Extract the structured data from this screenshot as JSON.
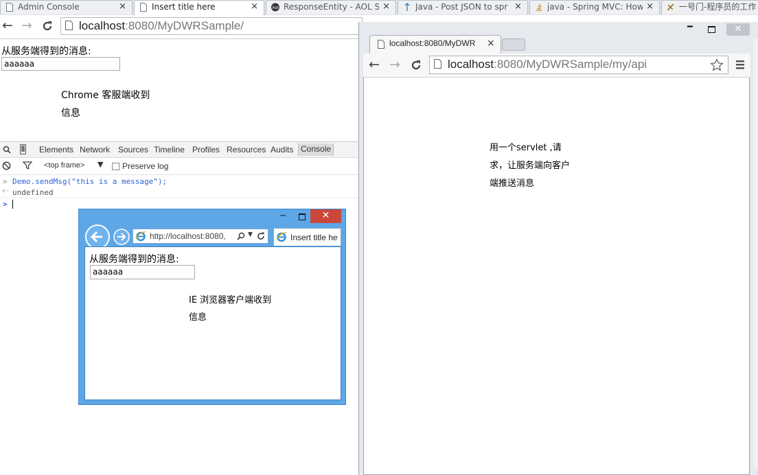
{
  "bg_browser": {
    "tabs": [
      {
        "label": "Admin Console",
        "icon": "page-icon",
        "close": "×",
        "active": false
      },
      {
        "label": "Insert title here",
        "icon": "page-icon",
        "close": "×",
        "active": true
      },
      {
        "label": "ResponseEntity - AOL S",
        "icon": "aol-icon",
        "close": "×",
        "active": false
      },
      {
        "label": "Java - Post JSON to spr",
        "icon": "stackoverflow-icon",
        "close": "×",
        "active": false
      },
      {
        "label": "java - Spring MVC: How",
        "icon": "stackoverflow-icon",
        "close": "×",
        "active": false
      },
      {
        "label": "一号门-程序员的工作",
        "icon": "site-icon",
        "close": "",
        "active": false
      }
    ],
    "url_host": "localhost",
    "url_rest": ":8080/MyDWRSample/",
    "page": {
      "message_label": "从服务端得到的消息:",
      "message_value": "aaaaaa",
      "annotation_line1": "Chrome 客服端收到",
      "annotation_line2": "信息"
    },
    "devtools": {
      "tabs": [
        "Elements",
        "Network",
        "Sources",
        "Timeline",
        "Profiles",
        "Resources",
        "Audits",
        "Console"
      ],
      "active_tab": "Console",
      "frame_select": "<top frame>",
      "preserve_log_label": "Preserve log",
      "console_input": "Demo.sendMsg(\"this is a message\");",
      "console_output": "undefined",
      "prompt": ">",
      "return_marker": "<·"
    }
  },
  "ie_window": {
    "address": "http://localhost:8080,",
    "tab_label": "Insert title he",
    "page": {
      "message_label": "从服务端得到的消息:",
      "message_value": "aaaaaa",
      "annotation_line1": "IE 浏览器客户端收到",
      "annotation_line2": "信息"
    }
  },
  "fg_browser": {
    "tab_label": "localhost:8080/MyDWR",
    "tab_close": "×",
    "url_host": "localhost",
    "url_rest": ":8080/MyDWRSample/my/api",
    "annotation_line1": "用一个servlet ,请",
    "annotation_line2": "求，让服务端向客户",
    "annotation_line3": "端推送消息"
  },
  "colors": {
    "ie_frame": "#5ea7e6",
    "ie_close": "#c9483a",
    "console_blue": "#2d64d8"
  }
}
